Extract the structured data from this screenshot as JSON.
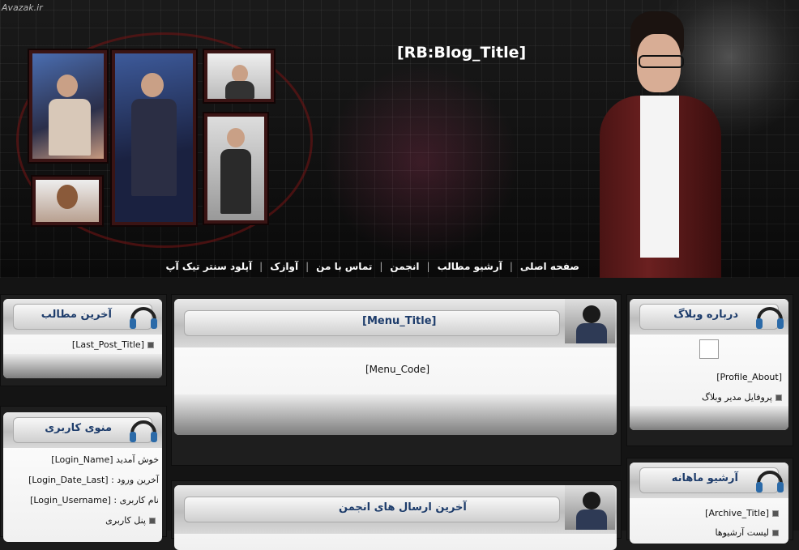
{
  "header": {
    "watermark": "Avazak.ir",
    "blog_title": "[RB:Blog_Title]",
    "nav": [
      {
        "label": "صفحه اصلی"
      },
      {
        "label": "آرشیو مطالب"
      },
      {
        "label": "انجمن"
      },
      {
        "label": "تماس با من"
      },
      {
        "label": "آوازک"
      },
      {
        "label": "آپلود سنتر تیک آپ"
      }
    ]
  },
  "left_column": {
    "latest_posts": {
      "title": "آخرین مطالب",
      "item": "[Last_Post_Title]"
    },
    "user_menu": {
      "title": "منوی کاربری",
      "welcome_label": "خوش آمدید",
      "welcome_value": "[Login_Name]",
      "last_login_label": "آخرین ورود :",
      "last_login_value": "[Login_Date_Last]",
      "username_label": "نام کاربری :",
      "username_value": "[Login_Username]",
      "panel_link": "پنل کاربری"
    }
  },
  "center_column": {
    "menu_box": {
      "title": "[Menu_Title]",
      "code": "[Menu_Code]"
    },
    "forum_box": {
      "title": "آخرین ارسال های انجمن"
    }
  },
  "right_column": {
    "about": {
      "title": "درباره وبلاگ",
      "profile_about": "[Profile_About]",
      "profile_link": "پروفایل مدیر وبلاگ"
    },
    "archive": {
      "title": "آرشیو ماهانه",
      "item": "[Archive_Title]",
      "cut_item": "لیست آرشیوها"
    }
  },
  "colors": {
    "box_title": "#1d3c6b",
    "page_bg": "#1b1b1b",
    "nav_text": "#ffffff"
  }
}
